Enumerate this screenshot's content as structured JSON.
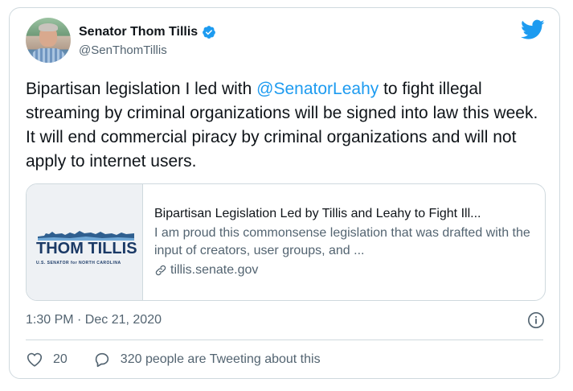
{
  "author": {
    "display_name": "Senator Thom Tillis",
    "handle": "@SenThomTillis"
  },
  "tweet": {
    "text_before": "Bipartisan legislation I led with ",
    "mention": "@SenatorLeahy",
    "text_after": " to fight illegal streaming by criminal organizations will be signed into law this week. It will end commercial piracy by criminal organizations and will not apply to internet users."
  },
  "link_card": {
    "logo_text": "THOM TILLIS",
    "logo_subtext": "U.S. SENATOR for NORTH CAROLINA",
    "title": "Bipartisan Legislation Led by Tillis and Leahy to Fight Ill...",
    "description": "I am proud this commonsense legislation that was drafted with the input of creators, user groups, and ...",
    "domain": "tillis.senate.gov"
  },
  "timestamp": "1:30 PM · Dec 21, 2020",
  "actions": {
    "likes": "20",
    "tweeting_text": "320 people are Tweeting about this"
  },
  "colors": {
    "accent": "#1d9bf0",
    "text_primary": "#0f1419",
    "text_secondary": "#536471",
    "border": "#cfd9de"
  },
  "icons": [
    "verified-badge-icon",
    "twitter-logo-icon",
    "link-icon",
    "info-icon",
    "heart-icon",
    "speech-bubble-icon"
  ]
}
